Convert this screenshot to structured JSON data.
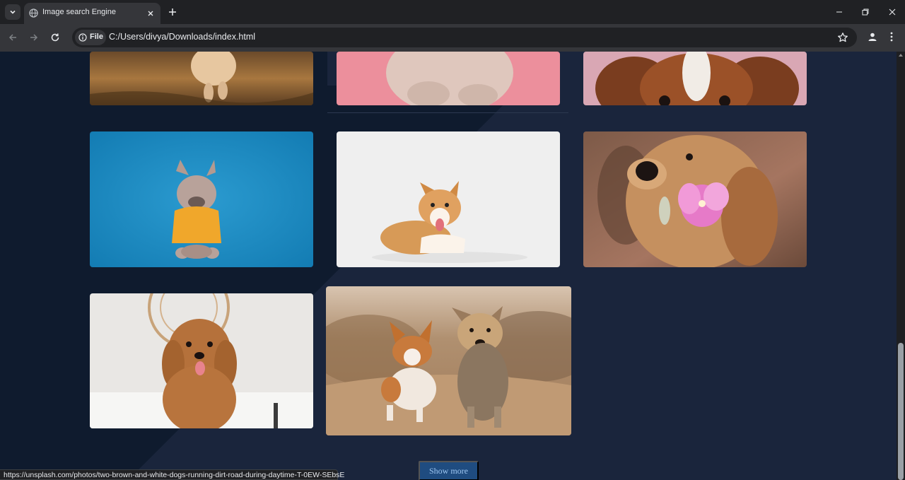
{
  "browser": {
    "tab_title": "Image search Engine",
    "url_chip": "File",
    "url": "C:/Users/divya/Downloads/index.html",
    "status_url": "https://unsplash.com/photos/two-brown-and-white-dogs-running-dirt-road-during-daytime-T-0EW-SEbsE"
  },
  "icons": {
    "tab_search": "chevron-down-icon",
    "favicon": "globe-icon",
    "tab_close": "close-icon",
    "new_tab": "plus-icon",
    "back": "arrow-left-icon",
    "forward": "arrow-right-icon",
    "reload": "reload-icon",
    "site_info": "info-icon",
    "bookmark": "star-icon",
    "profile": "person-icon",
    "menu": "kebab-menu-icon",
    "minimize": "minimize-icon",
    "restore": "restore-icon",
    "close_window": "close-icon"
  },
  "gallery": {
    "images": [
      {
        "subject": "puppy running on grass at sunset"
      },
      {
        "subject": "fluffy puppy on pink background"
      },
      {
        "subject": "brown and white spaniel on pink background"
      },
      {
        "subject": "french bulldog in yellow sweater on blue background"
      },
      {
        "subject": "corgi lying on white background"
      },
      {
        "subject": "golden retriever holding pink flower"
      },
      {
        "subject": "curly brown doodle sitting on bed"
      },
      {
        "subject": "two brown and white dogs running dirt road during daytime"
      }
    ],
    "show_more_label": "Show more"
  },
  "colors": {
    "page_dark": "#0f1b2e",
    "page_light": "#1a253c",
    "button": "#1f4c80",
    "button_text": "#9ec7f2"
  }
}
